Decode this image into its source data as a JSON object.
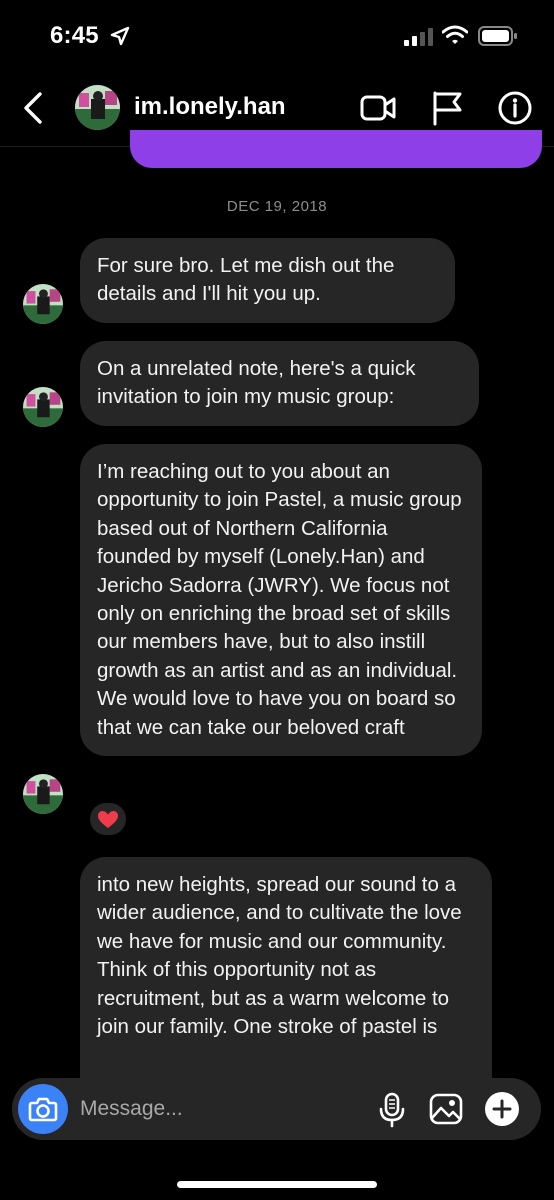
{
  "status_bar": {
    "time": "6:45"
  },
  "header": {
    "username": "im.lonely.han"
  },
  "conversation": {
    "date_separator": "DEC 19, 2018",
    "messages": [
      {
        "text": "For sure bro. Let me dish out the details and I'll hit you up."
      },
      {
        "text": "On a unrelated note, here's a quick invitation to join my music group:"
      },
      {
        "text": "I’m reaching out to you about an opportunity to join Pastel, a music group based out of Northern California founded by myself (Lonely.Han) and Jericho Sadorra (JWRY). We focus not only on enriching the broad set of skills our members have, but to also instill growth as an artist and as an individual. We would love to have you on board so that we can take our beloved craft",
        "reaction": "❤️"
      },
      {
        "text": "into new heights, spread our sound to a wider audience, and to cultivate the love we have for music and our community. Think of this opportunity not as recruitment, but as a warm welcome to join our family. One stroke of pastel is"
      }
    ]
  },
  "composer": {
    "placeholder": "Message..."
  },
  "colors": {
    "accent_purple": "#8f3fe8",
    "bubble": "#262626",
    "camera_blue": "#3b82f6"
  }
}
